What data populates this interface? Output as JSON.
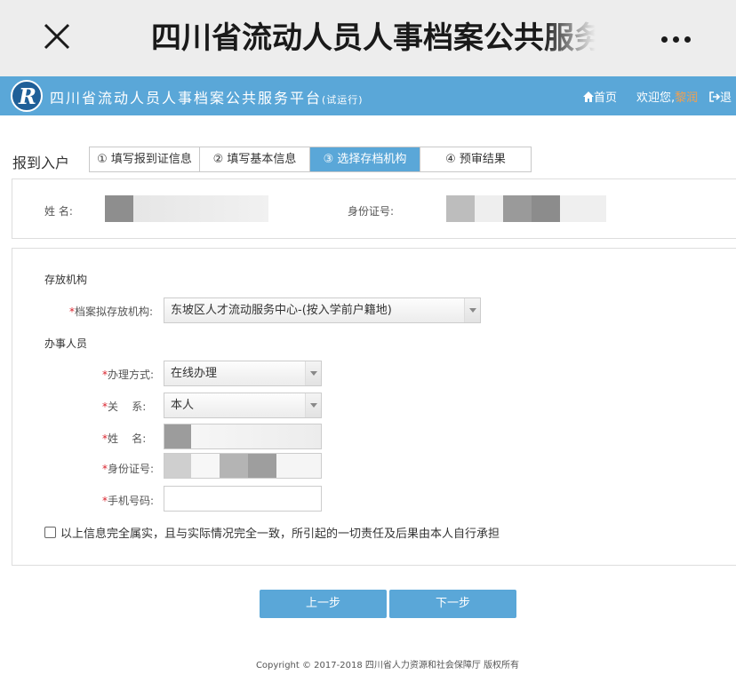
{
  "wechat": {
    "title": "四川省流动人员人事档案公共服务"
  },
  "header": {
    "site_name": "四川省流动人员人事档案公共服务平台",
    "site_badge": "(试运行)",
    "home_label": "首页",
    "welcome_label": "欢迎您,",
    "user_name": "黎润",
    "logout_label": "退"
  },
  "steps": {
    "label": "报到入户",
    "items": [
      {
        "label": "① 填写报到证信息",
        "active": false
      },
      {
        "label": "② 填写基本信息",
        "active": false
      },
      {
        "label": "③ 选择存档机构",
        "active": true
      },
      {
        "label": "④ 预审结果",
        "active": false
      }
    ]
  },
  "basic_info": {
    "name_label": "姓 名:",
    "id_label": "身份证号:"
  },
  "storage": {
    "section_title": "存放机构",
    "org_label": "档案拟存放机构:",
    "org_value": "东坡区人才流动服务中心-(按入学前户籍地)"
  },
  "handler": {
    "section_title": "办事人员",
    "method_label": "办理方式:",
    "method_value": "在线办理",
    "relation_label": "关    系:",
    "relation_value": "本人",
    "name_label": "姓    名:",
    "id_label": "身份证号:",
    "phone_label": "手机号码:"
  },
  "required_mark": "*",
  "agreement": "以上信息完全属实，且与实际情况完全一致，所引起的一切责任及后果由本人自行承担",
  "buttons": {
    "prev": "上一步",
    "next": "下一步"
  },
  "footer": "Copyright © 2017-2018 四川省人力资源和社会保障厅 版权所有",
  "colors": {
    "header_bg": "#5aa7d8",
    "button_bg": "#5aa7d8",
    "required": "#d9232d",
    "username": "#f0a050"
  }
}
